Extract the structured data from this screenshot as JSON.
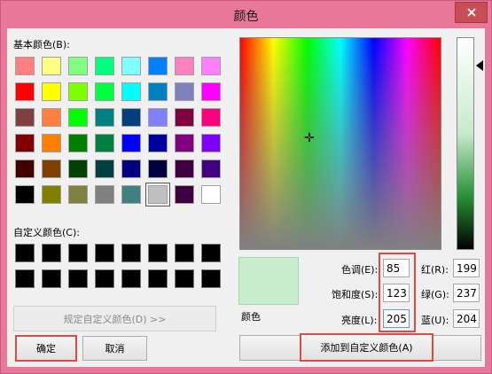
{
  "window": {
    "title": "颜色"
  },
  "labels": {
    "basic_colors": "基本颜色(B):",
    "custom_colors": "自定义颜色(C):",
    "preview": "颜色",
    "hue": "色调(E):",
    "saturation": "饱和度(S):",
    "luminance": "亮度(L):",
    "red": "红(R):",
    "green": "绿(G):",
    "blue": "蓝(U):"
  },
  "buttons": {
    "define_custom": "规定自定义颜色(D) >>",
    "ok": "确定",
    "cancel": "取消",
    "add_custom": "添加到自定义颜色(A)"
  },
  "values": {
    "hue": "85",
    "saturation": "123",
    "luminance": "205",
    "red": "199",
    "green": "237",
    "blue": "204"
  },
  "basic_colors": [
    "#ff8080",
    "#ffff80",
    "#80ff80",
    "#00ff80",
    "#80ffff",
    "#0080ff",
    "#ff80c0",
    "#ff80ff",
    "#ff0000",
    "#ffff00",
    "#80ff00",
    "#00ff40",
    "#00ffff",
    "#0080c0",
    "#8080c0",
    "#ff00ff",
    "#804040",
    "#ff8040",
    "#00ff00",
    "#008080",
    "#004080",
    "#8080ff",
    "#800040",
    "#ff0080",
    "#800000",
    "#ff8000",
    "#008000",
    "#008040",
    "#0000ff",
    "#0000a0",
    "#800080",
    "#8000ff",
    "#400000",
    "#804000",
    "#004000",
    "#004040",
    "#000080",
    "#000040",
    "#400040",
    "#400080",
    "#000000",
    "#808000",
    "#808040",
    "#808080",
    "#408080",
    "#c0c0c0",
    "#400040",
    "#ffffff"
  ],
  "selected_basic_color": "#c0c0c0",
  "preview_color": "#c7edcc"
}
